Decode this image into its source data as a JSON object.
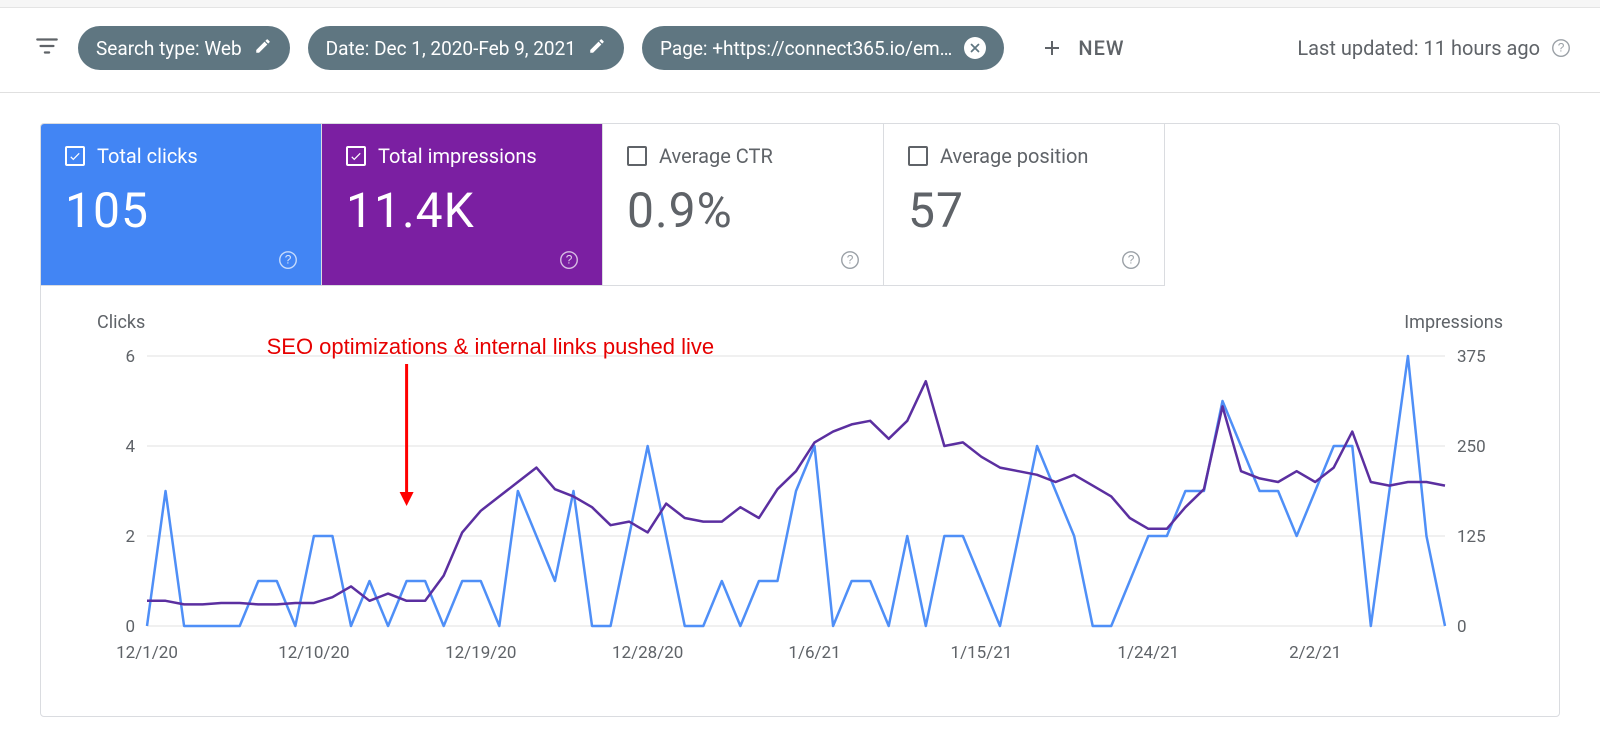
{
  "filters": {
    "search_type": "Search type: Web",
    "date": "Date: Dec 1, 2020-Feb 9, 2021",
    "page": "Page: +https://connect365.io/em…",
    "new_label": "NEW"
  },
  "updated_label": "Last updated: 11 hours ago",
  "metrics": {
    "clicks": {
      "label": "Total clicks",
      "value": "105",
      "checked": true
    },
    "impressions": {
      "label": "Total impressions",
      "value": "11.4K",
      "checked": true
    },
    "ctr": {
      "label": "Average CTR",
      "value": "0.9%",
      "checked": false
    },
    "position": {
      "label": "Average position",
      "value": "57",
      "checked": false
    }
  },
  "annotation": "SEO optimizations & internal links pushed live",
  "chart_data": {
    "type": "line",
    "x_dates": [
      "12/1/20",
      "12/2/20",
      "12/3/20",
      "12/4/20",
      "12/5/20",
      "12/6/20",
      "12/7/20",
      "12/8/20",
      "12/9/20",
      "12/10/20",
      "12/11/20",
      "12/12/20",
      "12/13/20",
      "12/14/20",
      "12/15/20",
      "12/16/20",
      "12/17/20",
      "12/18/20",
      "12/19/20",
      "12/20/20",
      "12/21/20",
      "12/22/20",
      "12/23/20",
      "12/24/20",
      "12/25/20",
      "12/26/20",
      "12/27/20",
      "12/28/20",
      "12/29/20",
      "12/30/20",
      "12/31/20",
      "1/1/21",
      "1/2/21",
      "1/3/21",
      "1/4/21",
      "1/5/21",
      "1/6/21",
      "1/7/21",
      "1/8/21",
      "1/9/21",
      "1/10/21",
      "1/11/21",
      "1/12/21",
      "1/13/21",
      "1/14/21",
      "1/15/21",
      "1/16/21",
      "1/17/21",
      "1/18/21",
      "1/19/21",
      "1/20/21",
      "1/21/21",
      "1/22/21",
      "1/23/21",
      "1/24/21",
      "1/25/21",
      "1/26/21",
      "1/27/21",
      "1/28/21",
      "1/29/21",
      "1/30/21",
      "1/31/21",
      "2/1/21",
      "2/2/21",
      "2/3/21",
      "2/4/21",
      "2/5/21",
      "2/6/21",
      "2/7/21",
      "2/8/21",
      "2/9/21"
    ],
    "x_tick_labels": [
      "12/1/20",
      "12/10/20",
      "12/19/20",
      "12/28/20",
      "1/6/21",
      "1/15/21",
      "1/24/21",
      "2/2/21"
    ],
    "series": [
      {
        "name": "Clicks",
        "axis": "left",
        "color": "#4f8ff7",
        "values": [
          0,
          3,
          0,
          0,
          0,
          0,
          1,
          1,
          0,
          2,
          2,
          0,
          1,
          0,
          1,
          1,
          0,
          1,
          1,
          0,
          3,
          2,
          1,
          3,
          0,
          0,
          2,
          4,
          2,
          0,
          0,
          1,
          0,
          1,
          1,
          3,
          4,
          0,
          1,
          1,
          0,
          2,
          0,
          2,
          2,
          1,
          0,
          2,
          4,
          3,
          2,
          0,
          0,
          1,
          2,
          2,
          3,
          3,
          5,
          4,
          3,
          3,
          2,
          3,
          4,
          4,
          0,
          3,
          6,
          2,
          0
        ]
      },
      {
        "name": "Impressions",
        "axis": "right",
        "color": "#5b2fa0",
        "values": [
          35,
          35,
          30,
          30,
          32,
          32,
          30,
          30,
          32,
          32,
          40,
          55,
          35,
          45,
          35,
          35,
          70,
          130,
          160,
          180,
          200,
          220,
          190,
          180,
          165,
          140,
          145,
          130,
          170,
          150,
          145,
          145,
          165,
          150,
          190,
          215,
          255,
          270,
          280,
          285,
          260,
          285,
          340,
          250,
          255,
          235,
          220,
          215,
          210,
          200,
          210,
          195,
          180,
          150,
          135,
          135,
          165,
          190,
          305,
          215,
          205,
          200,
          215,
          200,
          220,
          270,
          200,
          195,
          200,
          200,
          195
        ]
      }
    ],
    "left_axis": {
      "label": "Clicks",
      "min": 0,
      "max": 6,
      "ticks": [
        0,
        2,
        4,
        6
      ]
    },
    "right_axis": {
      "label": "Impressions",
      "min": 0,
      "max": 375,
      "ticks": [
        0,
        125,
        250,
        375
      ]
    },
    "annotation_x_index": 14
  }
}
